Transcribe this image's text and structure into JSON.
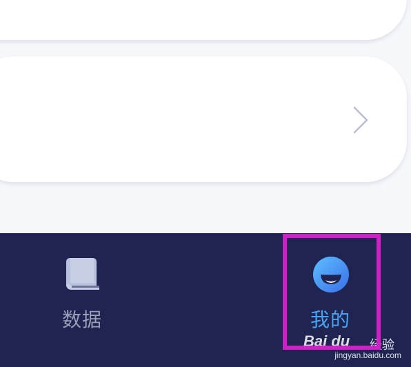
{
  "tabbar": {
    "tabs": [
      {
        "label": "数据",
        "icon": "book-icon",
        "selected": false
      },
      {
        "label": "我的",
        "icon": "smile-face-icon",
        "selected": true
      }
    ],
    "background": "#202451",
    "active_color": "#4aa3f2",
    "inactive_color": "#9ba0b8"
  },
  "list": {
    "chevron_icon": "chevron-right-icon"
  },
  "highlight_color": "#d21fc8",
  "watermark": {
    "brand": "Bai du",
    "brand_suffix": "经验",
    "url": "jingyan.baidu.com"
  }
}
